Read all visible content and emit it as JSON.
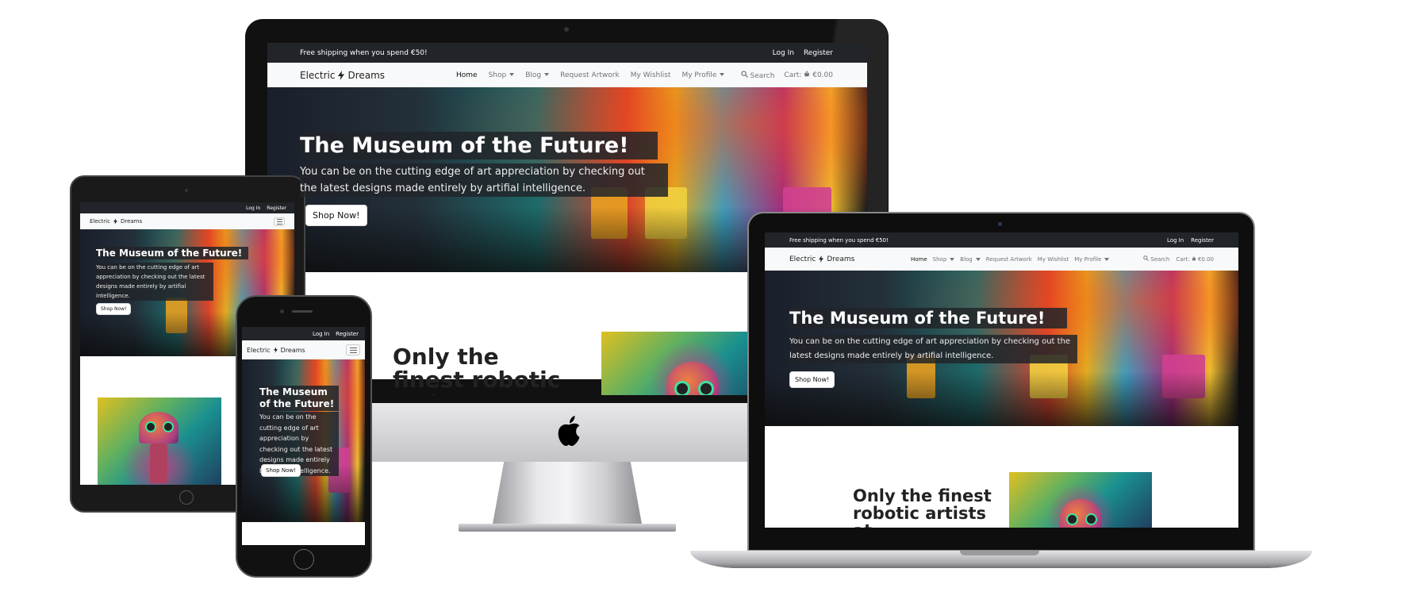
{
  "site": {
    "promo": "Free shipping when you spend €50!",
    "login": "Log In",
    "register": "Register",
    "brand_left": "Electric",
    "brand_right": "Dreams",
    "nav": {
      "home": "Home",
      "shop": "Shop",
      "blog": "Blog",
      "request": "Request Artwork",
      "wishlist": "My Wishlist",
      "profile": "My Profile"
    },
    "search": "Search",
    "cart_label": "Cart:",
    "cart_total": "€0.00",
    "hero_title": "The Museum of the Future!",
    "hero_text": "You can be on the cutting edge of art appreciation by checking out the latest designs made entirely by artifial intelligence.",
    "hero_button": "Shop Now!",
    "section_heading": "Only the finest robotic artists at"
  },
  "icons": {
    "bolt": "lightning-bolt-icon",
    "search": "search-icon",
    "cart": "shopping-basket-icon",
    "menu": "hamburger-menu-icon",
    "apple": "apple-logo-icon"
  },
  "colors": {
    "topbar": "#212529",
    "navbar": "#f8f9fa",
    "hero_overlay": "#212529"
  }
}
